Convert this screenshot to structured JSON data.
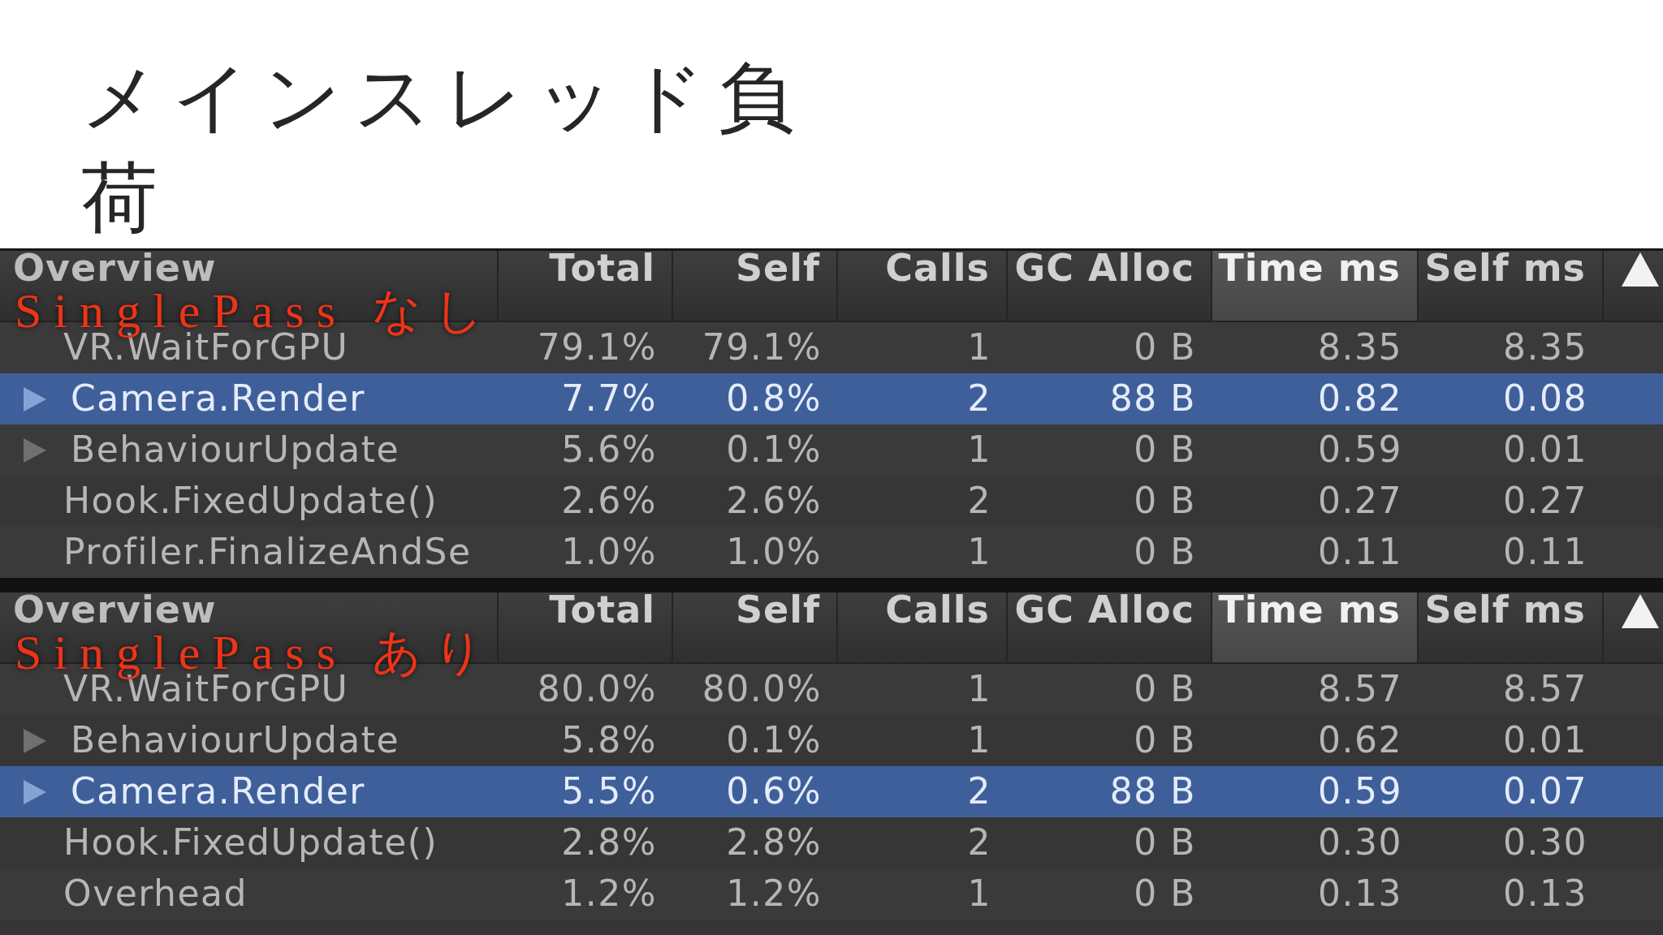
{
  "slide": {
    "title": "メインスレッド負荷"
  },
  "profilers": [
    {
      "caption": "SinglePass なし",
      "columns": [
        {
          "label": "Overview",
          "sorted": false
        },
        {
          "label": "Total",
          "sorted": false
        },
        {
          "label": "Self",
          "sorted": false
        },
        {
          "label": "Calls",
          "sorted": false
        },
        {
          "label": "GC Alloc",
          "sorted": false
        },
        {
          "label": "Time ms",
          "sorted": true
        },
        {
          "label": "Self ms",
          "sorted": false
        }
      ],
      "rows": [
        {
          "name": "VR.WaitForGPU",
          "expandable": false,
          "selected": false,
          "values": [
            "79.1%",
            "79.1%",
            "1",
            "0 B",
            "8.35",
            "8.35"
          ]
        },
        {
          "name": "Camera.Render",
          "expandable": true,
          "selected": true,
          "values": [
            "7.7%",
            "0.8%",
            "2",
            "88 B",
            "0.82",
            "0.08"
          ]
        },
        {
          "name": "BehaviourUpdate",
          "expandable": true,
          "selected": false,
          "values": [
            "5.6%",
            "0.1%",
            "1",
            "0 B",
            "0.59",
            "0.01"
          ]
        },
        {
          "name": "Hook.FixedUpdate()",
          "expandable": false,
          "selected": false,
          "values": [
            "2.6%",
            "2.6%",
            "2",
            "0 B",
            "0.27",
            "0.27"
          ]
        },
        {
          "name": "Profiler.FinalizeAndSe",
          "expandable": false,
          "selected": false,
          "values": [
            "1.0%",
            "1.0%",
            "1",
            "0 B",
            "0.11",
            "0.11"
          ]
        }
      ]
    },
    {
      "caption": "SinglePass あり",
      "columns": [
        {
          "label": "Overview",
          "sorted": false
        },
        {
          "label": "Total",
          "sorted": false
        },
        {
          "label": "Self",
          "sorted": false
        },
        {
          "label": "Calls",
          "sorted": false
        },
        {
          "label": "GC Alloc",
          "sorted": false
        },
        {
          "label": "Time ms",
          "sorted": true
        },
        {
          "label": "Self ms",
          "sorted": false
        }
      ],
      "rows": [
        {
          "name": "VR.WaitForGPU",
          "expandable": false,
          "selected": false,
          "values": [
            "80.0%",
            "80.0%",
            "1",
            "0 B",
            "8.57",
            "8.57"
          ]
        },
        {
          "name": "BehaviourUpdate",
          "expandable": true,
          "selected": false,
          "values": [
            "5.8%",
            "0.1%",
            "1",
            "0 B",
            "0.62",
            "0.01"
          ]
        },
        {
          "name": "Camera.Render",
          "expandable": true,
          "selected": true,
          "values": [
            "5.5%",
            "0.6%",
            "2",
            "88 B",
            "0.59",
            "0.07"
          ]
        },
        {
          "name": "Hook.FixedUpdate()",
          "expandable": false,
          "selected": false,
          "values": [
            "2.8%",
            "2.8%",
            "2",
            "0 B",
            "0.30",
            "0.30"
          ]
        },
        {
          "name": "Overhead",
          "expandable": false,
          "selected": false,
          "values": [
            "1.2%",
            "1.2%",
            "1",
            "0 B",
            "0.13",
            "0.13"
          ]
        }
      ]
    }
  ]
}
